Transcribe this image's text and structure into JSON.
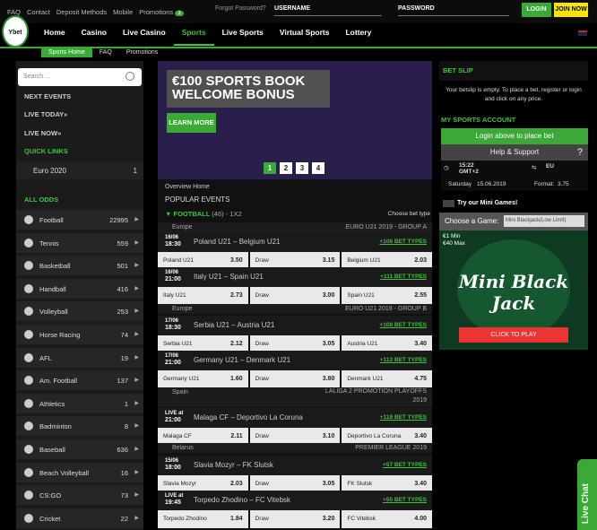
{
  "top": {
    "links": [
      "FAQ",
      "Contact",
      "Deposit Methods",
      "Mobile",
      "Promotions"
    ],
    "promo_badge": "3",
    "forgot": "Forgot Password?",
    "username": "USERNAME",
    "password": "PASSWORD",
    "login": "LOGIN",
    "join": "JOIN NOW"
  },
  "logo_text": "Ybet",
  "nav": [
    "Home",
    "Casino",
    "Live Casino",
    "Sports",
    "Live Sports",
    "Virtual Sports",
    "Lottery"
  ],
  "subnav": [
    "Sports Home",
    "FAQ",
    "Promotions"
  ],
  "left": {
    "search_placeholder": "Search ...",
    "next_events": "NEXT EVENTS",
    "live_today": "LIVE TODAY»",
    "live_now": "LIVE NOW»",
    "quick_links": "QUICK LINKS",
    "euro": {
      "name": "Euro 2020",
      "count": "1"
    },
    "all_odds": "ALL ODDS",
    "sports": [
      {
        "name": "Football",
        "count": "22995",
        "icon": "football-icon"
      },
      {
        "name": "Tennis",
        "count": "559",
        "icon": "tennis-icon"
      },
      {
        "name": "Basketball",
        "count": "501",
        "icon": "basketball-icon"
      },
      {
        "name": "Handball",
        "count": "416",
        "icon": "handball-icon"
      },
      {
        "name": "Volleyball",
        "count": "253",
        "icon": "volleyball-icon"
      },
      {
        "name": "Horse Racing",
        "count": "74",
        "icon": "horseshoe-icon"
      },
      {
        "name": "AFL",
        "count": "19",
        "icon": "afl-ball-icon"
      },
      {
        "name": "Am. Football",
        "count": "137",
        "icon": "american-football-icon"
      },
      {
        "name": "Athletics",
        "count": "1",
        "icon": "athletics-icon"
      },
      {
        "name": "Badminton",
        "count": "8",
        "icon": "shuttlecock-icon"
      },
      {
        "name": "Baseball",
        "count": "636",
        "icon": "baseball-icon"
      },
      {
        "name": "Beach Volleyball",
        "count": "16",
        "icon": "beach-volleyball-icon"
      },
      {
        "name": "CS:GO",
        "count": "73",
        "icon": "csgo-icon"
      },
      {
        "name": "Cricket",
        "count": "22",
        "icon": "cricket-icon"
      }
    ]
  },
  "banner": {
    "line1": "€100 SPORTS BOOK",
    "line2": "WELCOME BONUS",
    "learn_more": "LEARN MORE",
    "pages": [
      "1",
      "2",
      "3",
      "4"
    ]
  },
  "center": {
    "overview": "Overview Home",
    "popular": "POPULAR EVENTS",
    "football_label": "▼ FOOTBALL",
    "football_extra": "(46) - 1X2",
    "choose_bet": "Choose bet type",
    "draw": "Draw",
    "leagues": [
      {
        "left": "Europe",
        "right": "EURO U21 2019 - GROUP A"
      },
      {
        "left": "Europe",
        "right": "EURO U21 2019 - GROUP B"
      },
      {
        "left": "Spain",
        "right": "LALIGA 2 PROMOTION PLAYOFFS 2019"
      },
      {
        "left": "Belarus",
        "right": "PREMIER LEAGUE 2019"
      }
    ],
    "matches": [
      {
        "d1": "16/06",
        "d2": "18:30",
        "name": "Poland U21 – Belgium U21",
        "bets": "+106 BET TYPES",
        "home": "Poland U21",
        "h": "3.50",
        "dr": "3.15",
        "away": "Belgium U21",
        "a": "2.03"
      },
      {
        "d1": "16/06",
        "d2": "21:00",
        "name": "Italy U21 – Spain U21",
        "bets": "+111 BET TYPES",
        "home": "Italy U21",
        "h": "2.73",
        "dr": "3.00",
        "away": "Spain U21",
        "a": "2.55"
      },
      {
        "d1": "17/06",
        "d2": "18:30",
        "name": "Serbia U21 – Austria U21",
        "bets": "+108 BET TYPES",
        "home": "Serbia U21",
        "h": "2.12",
        "dr": "3.05",
        "away": "Austria U21",
        "a": "3.40"
      },
      {
        "d1": "17/06",
        "d2": "21:00",
        "name": "Germany U21 – Denmark U21",
        "bets": "+112 BET TYPES",
        "home": "Germany U21",
        "h": "1.60",
        "dr": "3.80",
        "away": "Denmark U21",
        "a": "4.75"
      },
      {
        "d1": "LIVE at",
        "d2": "21:00",
        "name": "Malaga CF – Deportivo La Coruna",
        "bets": "+119 BET TYPES",
        "home": "Malaga CF",
        "h": "2.11",
        "dr": "3.10",
        "away": "Deportivo La Coruna",
        "a": "3.40"
      },
      {
        "d1": "15/06",
        "d2": "18:00",
        "name": "Slavia Mozyr – FK Slutsk",
        "bets": "+57 BET TYPES",
        "home": "Slavia Mozyr",
        "h": "2.03",
        "dr": "3.05",
        "away": "FK Slutsk",
        "a": "3.40"
      },
      {
        "d1": "LIVE at",
        "d2": "19:45",
        "name": "Torpedo Zhodino – FC Vitebsk",
        "bets": "+55 BET TYPES",
        "home": "Torpedo Zhodino",
        "h": "1.84",
        "dr": "3.20",
        "away": "FC Vitebsk",
        "a": "4.00"
      }
    ]
  },
  "right": {
    "bet_slip": "BET SLIP",
    "empty": "Your betslip is empty. To place a bet, register or login and click on any price.",
    "my_account": "MY SPORTS ACCOUNT",
    "login_btn": "Login above to place bet",
    "help": "Help & Support",
    "time": "15:22",
    "tz": "GMT+2",
    "region": "EU",
    "day": "Saturday",
    "date": "15.06.2019",
    "format_label": "Format:",
    "format": "3.75",
    "mini_title": "Try our Mini Games!",
    "choose_game": "Choose a Game:",
    "game_select": "Mini Blackjack(Low Limit)",
    "game_name": "Mini Black Jack",
    "min": "€1 Min",
    "max": "€40 Max",
    "click_play": "CLICK TO PLAY"
  },
  "live_chat": "Live Chat"
}
